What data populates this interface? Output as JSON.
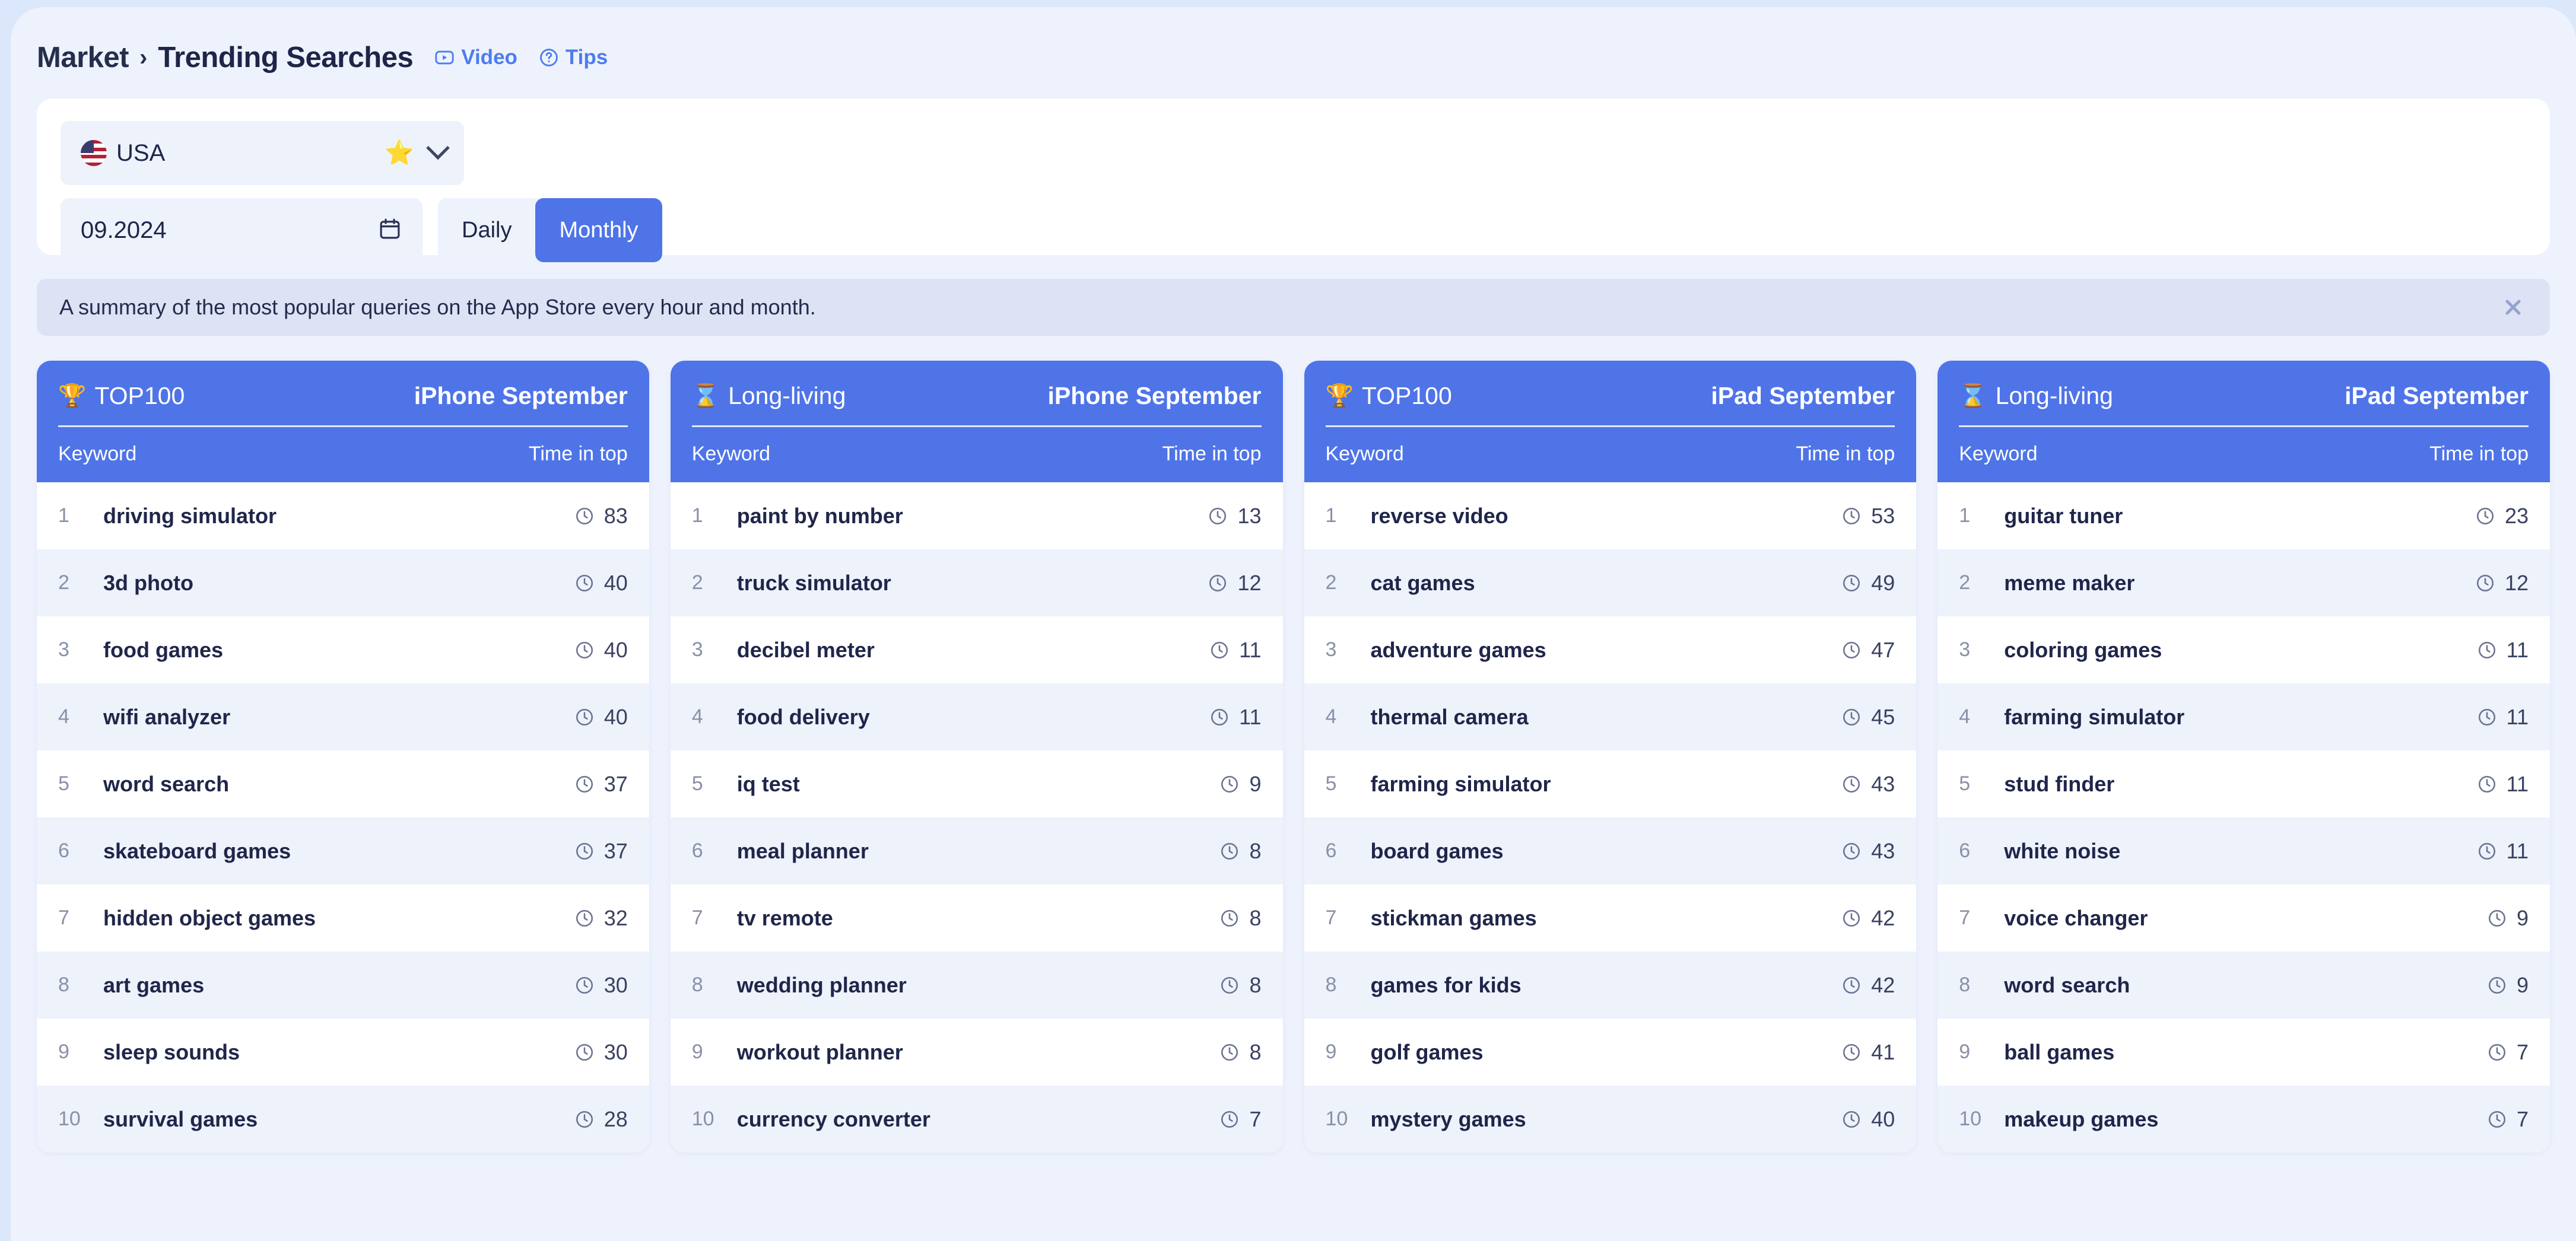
{
  "header": {
    "breadcrumb_root": "Market",
    "breadcrumb_separator": "›",
    "breadcrumb_current": "Trending Searches",
    "video_label": "Video",
    "tips_label": "Tips"
  },
  "filters": {
    "country": {
      "value": "USA",
      "flag_icon": "usa-flag-icon",
      "favorite_icon": "⭐"
    },
    "date": {
      "value": "09.2024",
      "calendar_icon": "calendar-icon"
    },
    "period": {
      "options": [
        "Daily",
        "Monthly"
      ],
      "selected": "Monthly",
      "daily_label": "Daily",
      "monthly_label": "Monthly"
    }
  },
  "banner": {
    "text": "A summary of the most popular queries on the App Store every hour and month.",
    "close_icon": "✕"
  },
  "colors": {
    "accent": "#4f74e8",
    "page_bg": "#eef2fd",
    "card_bg": "#ffffff",
    "row_alt_bg": "#eef2fb",
    "banner_bg": "#dde2f5",
    "text_dark": "#20264a",
    "link": "#4c7cf0"
  },
  "columns": {
    "keyword": "Keyword",
    "time_in_top": "Time in top"
  },
  "cards": [
    {
      "kind_icon": "🏆",
      "kind_icon_name": "trophy-icon",
      "kind": "TOP100",
      "scope": "iPhone September",
      "rows": [
        {
          "rank": "1",
          "keyword": "driving simulator",
          "time": "83"
        },
        {
          "rank": "2",
          "keyword": "3d photo",
          "time": "40"
        },
        {
          "rank": "3",
          "keyword": "food games",
          "time": "40"
        },
        {
          "rank": "4",
          "keyword": "wifi analyzer",
          "time": "40"
        },
        {
          "rank": "5",
          "keyword": "word search",
          "time": "37"
        },
        {
          "rank": "6",
          "keyword": "skateboard games",
          "time": "37"
        },
        {
          "rank": "7",
          "keyword": "hidden object games",
          "time": "32"
        },
        {
          "rank": "8",
          "keyword": "art games",
          "time": "30"
        },
        {
          "rank": "9",
          "keyword": "sleep sounds",
          "time": "30"
        },
        {
          "rank": "10",
          "keyword": "survival games",
          "time": "28"
        }
      ]
    },
    {
      "kind_icon": "⌛",
      "kind_icon_name": "hourglass-icon",
      "kind": "Long-living",
      "scope": "iPhone September",
      "rows": [
        {
          "rank": "1",
          "keyword": "paint by number",
          "time": "13"
        },
        {
          "rank": "2",
          "keyword": "truck simulator",
          "time": "12"
        },
        {
          "rank": "3",
          "keyword": "decibel meter",
          "time": "11"
        },
        {
          "rank": "4",
          "keyword": "food delivery",
          "time": "11"
        },
        {
          "rank": "5",
          "keyword": "iq test",
          "time": "9"
        },
        {
          "rank": "6",
          "keyword": "meal planner",
          "time": "8"
        },
        {
          "rank": "7",
          "keyword": "tv remote",
          "time": "8"
        },
        {
          "rank": "8",
          "keyword": "wedding planner",
          "time": "8"
        },
        {
          "rank": "9",
          "keyword": "workout planner",
          "time": "8"
        },
        {
          "rank": "10",
          "keyword": "currency converter",
          "time": "7"
        }
      ]
    },
    {
      "kind_icon": "🏆",
      "kind_icon_name": "trophy-icon",
      "kind": "TOP100",
      "scope": "iPad September",
      "rows": [
        {
          "rank": "1",
          "keyword": "reverse video",
          "time": "53"
        },
        {
          "rank": "2",
          "keyword": "cat games",
          "time": "49"
        },
        {
          "rank": "3",
          "keyword": "adventure games",
          "time": "47"
        },
        {
          "rank": "4",
          "keyword": "thermal camera",
          "time": "45"
        },
        {
          "rank": "5",
          "keyword": "farming simulator",
          "time": "43"
        },
        {
          "rank": "6",
          "keyword": "board games",
          "time": "43"
        },
        {
          "rank": "7",
          "keyword": "stickman games",
          "time": "42"
        },
        {
          "rank": "8",
          "keyword": "games for kids",
          "time": "42"
        },
        {
          "rank": "9",
          "keyword": "golf games",
          "time": "41"
        },
        {
          "rank": "10",
          "keyword": "mystery games",
          "time": "40"
        }
      ]
    },
    {
      "kind_icon": "⌛",
      "kind_icon_name": "hourglass-icon",
      "kind": "Long-living",
      "scope": "iPad September",
      "rows": [
        {
          "rank": "1",
          "keyword": "guitar tuner",
          "time": "23"
        },
        {
          "rank": "2",
          "keyword": "meme maker",
          "time": "12"
        },
        {
          "rank": "3",
          "keyword": "coloring games",
          "time": "11"
        },
        {
          "rank": "4",
          "keyword": "farming simulator",
          "time": "11"
        },
        {
          "rank": "5",
          "keyword": "stud finder",
          "time": "11"
        },
        {
          "rank": "6",
          "keyword": "white noise",
          "time": "11"
        },
        {
          "rank": "7",
          "keyword": "voice changer",
          "time": "9"
        },
        {
          "rank": "8",
          "keyword": "word search",
          "time": "9"
        },
        {
          "rank": "9",
          "keyword": "ball games",
          "time": "7"
        },
        {
          "rank": "10",
          "keyword": "makeup games",
          "time": "7"
        }
      ]
    }
  ]
}
